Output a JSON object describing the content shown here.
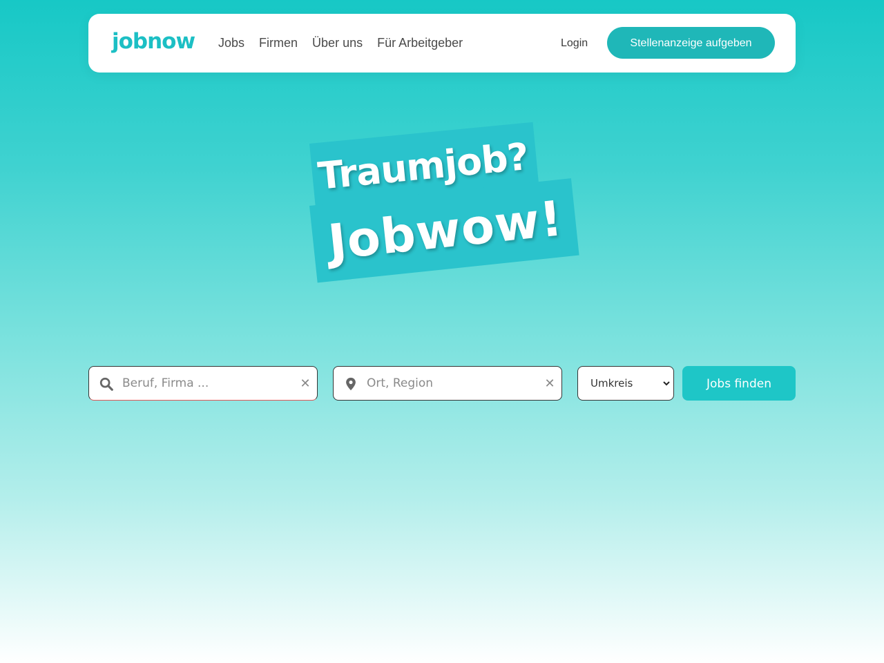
{
  "header": {
    "logo_text": "jobnow",
    "nav": [
      {
        "label": "Jobs"
      },
      {
        "label": "Firmen"
      },
      {
        "label": "Über uns"
      },
      {
        "label": "Für Arbeitgeber"
      }
    ],
    "login_label": "Login",
    "cta_label": "Stellenanzeige aufgeben"
  },
  "hero": {
    "line1": "Traumjob?",
    "line2": "Jobwow!"
  },
  "search": {
    "job_placeholder": "Beruf, Firma ...",
    "job_value": "",
    "location_placeholder": "Ort, Region",
    "location_value": "",
    "radius_selected": "Umkreis",
    "submit_label": "Jobs finden"
  },
  "colors": {
    "brand": "#1cbfc4",
    "cta": "#1fb7b8",
    "search_button": "#1ec6c7",
    "hero_highlight": "#2ac3cc"
  },
  "icons": {
    "job_field": "search-icon",
    "location_field": "map-pin-icon",
    "clear": "close-icon",
    "select": "chevron-down-icon"
  }
}
